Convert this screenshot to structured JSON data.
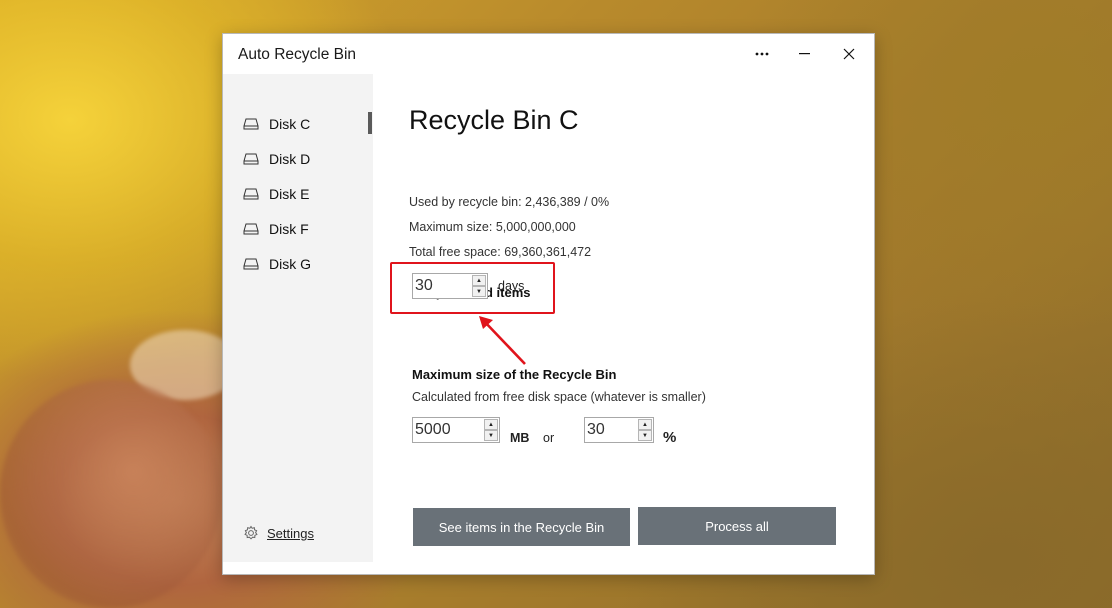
{
  "window": {
    "title": "Auto Recycle Bin"
  },
  "titlebar_buttons": {
    "more": "more-icon",
    "minimize": "minimize-icon",
    "close": "close-icon"
  },
  "sidebar": {
    "items": [
      {
        "label": "Disk C",
        "icon": "drive-icon",
        "selected": true
      },
      {
        "label": "Disk D",
        "icon": "drive-icon"
      },
      {
        "label": "Disk E",
        "icon": "drive-icon"
      },
      {
        "label": "Disk F",
        "icon": "drive-icon"
      },
      {
        "label": "Disk G",
        "icon": "drive-icon"
      }
    ],
    "settings_label": "Settings"
  },
  "main": {
    "title": "Recycle Bin C",
    "used": "Used by recycle bin: 2,436,389 / 0%",
    "max_size": "Maximum size: 5,000,000,000",
    "free_space": "Total free space: 69,360,361,472",
    "keep_section": {
      "title": "Keep deleted items",
      "value": "30",
      "unit": "days"
    },
    "max_section": {
      "title": "Maximum size of the Recycle Bin",
      "subtitle": "Calculated from free disk space (whatever is smaller)",
      "mb_value": "5000",
      "mb_unit": "MB",
      "or_label": "or",
      "percent_value": "30",
      "percent_unit": "%"
    },
    "buttons": {
      "see_items": "See items in the Recycle Bin",
      "process_all": "Process all"
    }
  },
  "colors": {
    "highlight": "#e0141c",
    "button_bg": "#697178",
    "sidebar_bg": "#f3f3f3"
  }
}
